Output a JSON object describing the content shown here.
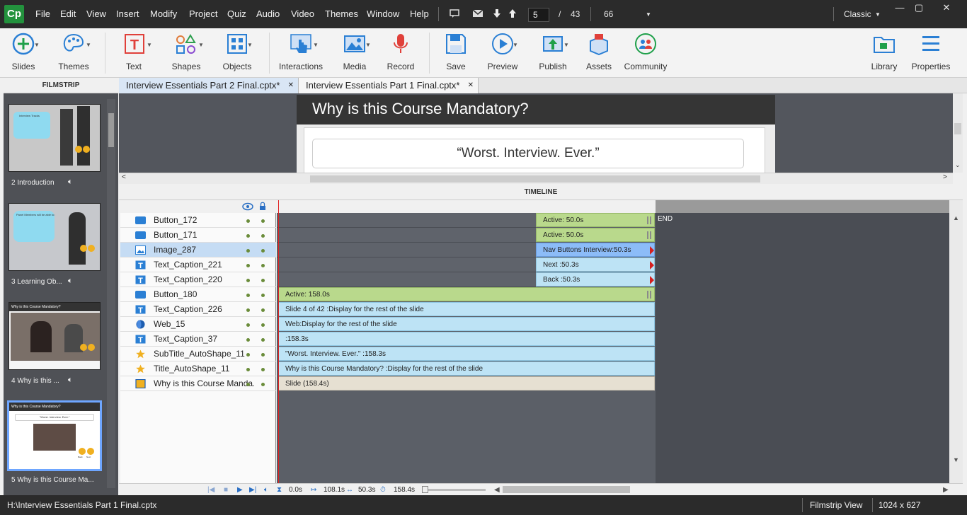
{
  "app": {
    "logo": "Cp"
  },
  "menu": [
    "File",
    "Edit",
    "View",
    "Insert",
    "Modify",
    "Project",
    "Quiz",
    "Audio",
    "Video",
    "Themes",
    "Window",
    "Help"
  ],
  "nav": {
    "current_slide": "5",
    "separator": "/",
    "total_slides": "43",
    "zoom": "66"
  },
  "workspace": "Classic",
  "toolbar": {
    "slides": "Slides",
    "themes": "Themes",
    "text": "Text",
    "shapes": "Shapes",
    "objects": "Objects",
    "interactions": "Interactions",
    "media": "Media",
    "record": "Record",
    "save": "Save",
    "preview": "Preview",
    "publish": "Publish",
    "assets": "Assets",
    "community": "Community",
    "library": "Library",
    "properties": "Properties"
  },
  "filmstrip": {
    "title": "FILMSTRIP",
    "items": [
      {
        "label": "2 Introduction"
      },
      {
        "label": "3 Learning Ob..."
      },
      {
        "label": "4 Why is this ..."
      },
      {
        "label": "5 Why is this Course Ma..."
      }
    ],
    "thumb_text": {
      "t2_heading": "Interview Tracks",
      "t3_heading": "Panel Members will be able to:",
      "t4_heading": "Why is this Course Mandatory?",
      "t5_heading": "Why is this Course Mandatory?",
      "t5_sub": "\"Worst. Interview. Ever.\"",
      "back": "Back",
      "next": "Next"
    }
  },
  "tabs": [
    {
      "label": "Interview Essentials Part 2 Final.cptx*"
    },
    {
      "label": "Interview Essentials Part 1 Final.cptx*"
    }
  ],
  "slide": {
    "title": "Why is this Course Mandatory?",
    "subtitle": "“Worst. Interview. Ever.”"
  },
  "timeline": {
    "title": "TIMELINE",
    "end_label": "END",
    "layers": [
      {
        "name": "Button_172",
        "icon": "button-icon",
        "bar": "Active: 50.0s"
      },
      {
        "name": "Button_171",
        "icon": "button-icon",
        "bar": "Active: 50.0s"
      },
      {
        "name": "Image_287",
        "icon": "image-icon",
        "bar": "Nav Buttons Interview:50.3s"
      },
      {
        "name": "Text_Caption_221",
        "icon": "text-caption-icon",
        "bar": "Next :50.3s"
      },
      {
        "name": "Text_Caption_220",
        "icon": "text-caption-icon",
        "bar": "Back :50.3s"
      },
      {
        "name": "Button_180",
        "icon": "button-icon",
        "bar": "Active: 158.0s"
      },
      {
        "name": "Text_Caption_226",
        "icon": "text-caption-icon",
        "bar": "Slide 4 of 42 :Display for the rest of the slide"
      },
      {
        "name": "Web_15",
        "icon": "web-icon",
        "bar": "Web:Display for the rest of the slide"
      },
      {
        "name": "Text_Caption_37",
        "icon": "text-caption-icon",
        "bar": " :158.3s"
      },
      {
        "name": "SubTitle_AutoShape_11",
        "icon": "star-icon",
        "bar": "\"Worst. Interview. Ever.\" :158.3s"
      },
      {
        "name": "Title_AutoShape_11",
        "icon": "star-icon",
        "bar": "Why is this Course Mandatory? :Display for the rest of the slide"
      },
      {
        "name": "Why is this Course Manda...",
        "icon": "slide-icon",
        "bar": "Slide (158.4s)"
      }
    ],
    "footer": {
      "current": "0.0s",
      "start": "108.1s",
      "duration": "50.3s",
      "total": "158.4s"
    }
  },
  "status": {
    "path": "H:\\Interview Essentials Part 1 Final.cptx",
    "view": "Filmstrip View",
    "resolution": "1024 x 627"
  }
}
